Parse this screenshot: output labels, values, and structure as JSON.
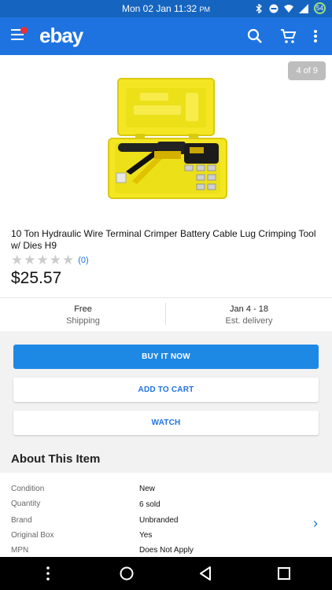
{
  "status_bar": {
    "time": "Mon 02 Jan 11:32",
    "time_suffix": "PM",
    "battery": "54"
  },
  "app_bar": {
    "logo": "ebay"
  },
  "image_gallery": {
    "counter": "4 of 9"
  },
  "listing": {
    "title": "10 Ton Hydraulic Wire Terminal Crimper Battery Cable Lug Crimping Tool w/ Dies H9",
    "rating_count": "(0)",
    "price": "$25.57",
    "shipping_value": "Free",
    "shipping_label": "Shipping",
    "delivery_value": "Jan 4 - 18",
    "delivery_label": "Est. delivery"
  },
  "actions": {
    "buy_now": "BUY IT NOW",
    "add_to_cart": "ADD TO CART",
    "watch": "WATCH"
  },
  "about": {
    "heading": "About This Item",
    "specs": [
      {
        "label": "Condition",
        "value": "New"
      },
      {
        "label": "Quantity",
        "value": "6 sold"
      },
      {
        "label": "Brand",
        "value": "Unbranded"
      },
      {
        "label": "Original Box",
        "value": "Yes"
      },
      {
        "label": "MPN",
        "value": "Does Not Apply"
      }
    ]
  },
  "colors": {
    "app_bar": "#1e73e0",
    "status_bar": "#1565c0",
    "primary_button": "#1e88e5",
    "notification_dot": "#e53238",
    "case_yellow": "#f5e623"
  }
}
